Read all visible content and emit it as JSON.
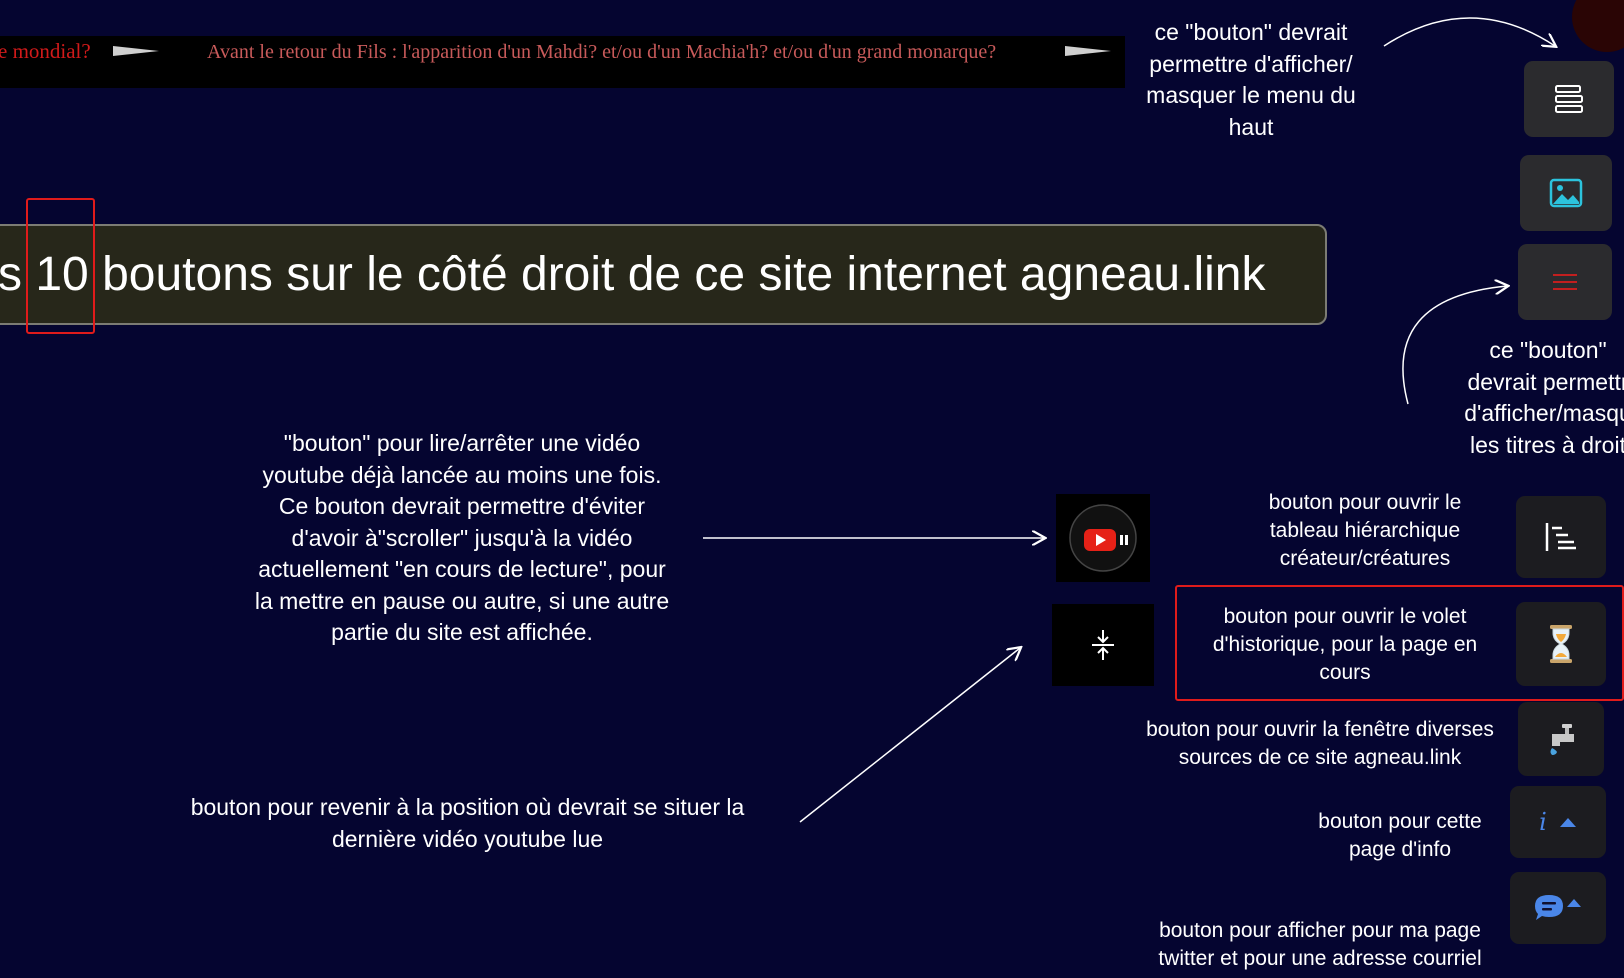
{
  "marquee": {
    "item1": "e mondial?",
    "item2": "Avant le retour du Fils : l'apparition d'un Mahdi? et/ou d'un Machia'h? et/ou d'un grand monarque?"
  },
  "banner": {
    "prefix": "s ",
    "count": "10",
    "suffix": " boutons sur le côté droit de ce site internet agneau.link"
  },
  "notes": {
    "top_menu": [
      "ce \"bouton\" devrait",
      "permettre d'afficher/",
      "masquer le menu du",
      "haut"
    ],
    "right_titles": [
      "ce \"bouton\"",
      "devrait permettr",
      "d'afficher/masqu",
      "les titres à droit"
    ],
    "youtube": [
      "\"bouton\" pour lire/arrêter une vidéo",
      "youtube déjà lancée au moins une fois.",
      "Ce bouton devrait permettre d'éviter",
      "d'avoir à\"scroller\" jusqu'à la vidéo",
      "actuellement \"en cours de lecture\", pour",
      "la mettre en pause ou autre, si une autre",
      "partie du site est affichée."
    ],
    "return_video": [
      "bouton pour revenir à la position où devrait se situer la",
      "dernière vidéo youtube lue"
    ],
    "hierarchy": [
      "bouton pour ouvrir le",
      "tableau hiérarchique",
      "créateur/créatures"
    ],
    "history": [
      "bouton pour ouvrir le volet",
      "d'historique, pour la page en",
      "cours"
    ],
    "sources": [
      "bouton pour ouvrir la fenêtre diverses",
      "sources de ce site agneau.link"
    ],
    "info": [
      "bouton pour cette",
      "page d'info"
    ],
    "twitter": [
      "bouton pour afficher pour ma page",
      "twitter et pour une adresse courriel"
    ]
  },
  "icons": {
    "menu": "menu-toggle-icon",
    "image": "image-icon",
    "titles": "hamburger-lines-icon",
    "youtube": "youtube-play-pause-icon",
    "scroll": "scroll-to-video-icon",
    "hierarchy": "hierarchy-tree-icon",
    "history": "hourglass-icon",
    "sources": "water-tap-icon",
    "info_glyph": "i",
    "chat": "chat-bubble-icon"
  },
  "colors": {
    "background": "#050530",
    "highlight": "#e01b1b",
    "marquee_text": "#d11a1a",
    "banner_bg": "#27271a",
    "image_icon": "#2cc3dd",
    "info_icon": "#4a86e8"
  }
}
